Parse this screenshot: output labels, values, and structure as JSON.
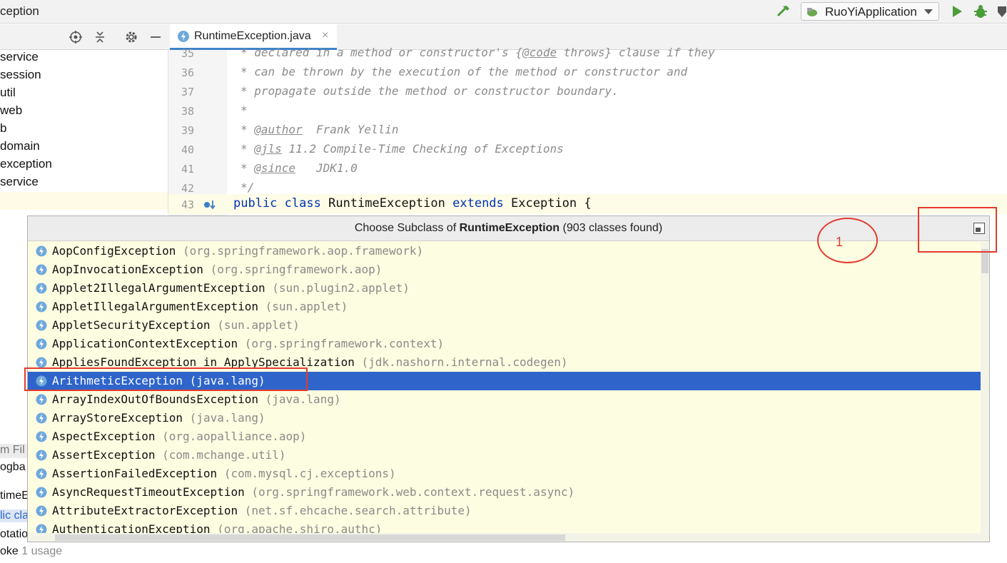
{
  "window": {
    "title": "ception",
    "run_config": "RuoYiApplication"
  },
  "editor": {
    "tab_label": "RuntimeException.java",
    "tab_close": "×",
    "lines": [
      {
        "n": "35",
        "parts": [
          {
            "t": "* declared in a method or constructor's {",
            "c": "c"
          },
          {
            "t": "@code",
            "c": "tag"
          },
          {
            "t": " throws} clause if they",
            "c": "c"
          }
        ]
      },
      {
        "n": "36",
        "parts": [
          {
            "t": "* can be thrown by the execution of the method or constructor and",
            "c": "c"
          }
        ]
      },
      {
        "n": "37",
        "parts": [
          {
            "t": "* propagate outside the method or constructor boundary.",
            "c": "c"
          }
        ]
      },
      {
        "n": "38",
        "parts": [
          {
            "t": "*",
            "c": "c"
          }
        ]
      },
      {
        "n": "39",
        "parts": [
          {
            "t": "* ",
            "c": "c"
          },
          {
            "t": "@author",
            "c": "tag"
          },
          {
            "t": "  Frank Yellin",
            "c": "c"
          }
        ]
      },
      {
        "n": "40",
        "parts": [
          {
            "t": "* ",
            "c": "c"
          },
          {
            "t": "@jls",
            "c": "tag"
          },
          {
            "t": " 11.2 Compile-Time Checking of Exceptions",
            "c": "c"
          }
        ]
      },
      {
        "n": "41",
        "parts": [
          {
            "t": "* ",
            "c": "c"
          },
          {
            "t": "@since",
            "c": "tag"
          },
          {
            "t": "   JDK1.0",
            "c": "c"
          }
        ]
      },
      {
        "n": "42",
        "parts": [
          {
            "t": "*/",
            "c": "c"
          }
        ]
      }
    ],
    "line43": {
      "n": "43",
      "kw1": "public",
      "kw2": "class",
      "name": "RuntimeException",
      "kw3": "extends",
      "base": "Exception {"
    }
  },
  "project_tree": {
    "items": [
      "service",
      "session",
      "util",
      "web",
      "b",
      "domain",
      "exception",
      "service"
    ]
  },
  "leftover_panel": {
    "lines": [
      "m Fil",
      "ogba",
      "timeE",
      "lic cla",
      "otatio"
    ]
  },
  "popup": {
    "title_prefix": "Choose Subclass of ",
    "title_class": "RuntimeException",
    "title_suffix": " (903 classes found)",
    "items": [
      {
        "name": "AopConfigException",
        "pkg": "(org.springframework.aop.framework)"
      },
      {
        "name": "AopInvocationException",
        "pkg": "(org.springframework.aop)"
      },
      {
        "name": "Applet2IllegalArgumentException",
        "pkg": "(sun.plugin2.applet)"
      },
      {
        "name": "AppletIllegalArgumentException",
        "pkg": "(sun.applet)"
      },
      {
        "name": "AppletSecurityException",
        "pkg": "(sun.applet)"
      },
      {
        "name": "ApplicationContextException",
        "pkg": "(org.springframework.context)"
      },
      {
        "name": "AppliesFoundException in ApplySpecialization",
        "pkg": "(jdk.nashorn.internal.codegen)"
      },
      {
        "name": "ArithmeticException",
        "pkg": "(java.lang)",
        "selected": true
      },
      {
        "name": "ArrayIndexOutOfBoundsException",
        "pkg": "(java.lang)"
      },
      {
        "name": "ArrayStoreException",
        "pkg": "(java.lang)"
      },
      {
        "name": "AspectException",
        "pkg": "(org.aopalliance.aop)"
      },
      {
        "name": "AssertException",
        "pkg": "(com.mchange.util)"
      },
      {
        "name": "AssertionFailedException",
        "pkg": "(com.mysql.cj.exceptions)"
      },
      {
        "name": "AsyncRequestTimeoutException",
        "pkg": "(org.springframework.web.context.request.async)"
      },
      {
        "name": "AttributeExtractorException",
        "pkg": "(net.sf.ehcache.search.attribute)"
      },
      {
        "name": "AuthenticationException",
        "pkg": "(org.apache.shiro.authc)"
      }
    ]
  },
  "annotation": {
    "number": "1",
    "color": "#e33b2e"
  },
  "usage": {
    "prefix": "oke",
    "text": "1 usage"
  },
  "colors": {
    "selection": "#2f65ca",
    "popup_bg": "#fdfde1",
    "keyword": "#0033b3",
    "tab_underline": "#4083c9"
  },
  "icons": {
    "class_icon": "exception-class-icon",
    "pin": "pin-window-icon"
  }
}
